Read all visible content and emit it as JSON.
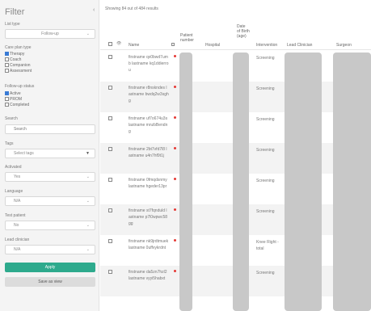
{
  "filters": {
    "title": "Filter",
    "collapse_icon": "chevron-left-icon",
    "list_type": {
      "label": "List type",
      "value": "Follow-up"
    },
    "care_plan_type": {
      "label": "Care plan type",
      "options": [
        {
          "label": "Therapy",
          "checked": true
        },
        {
          "label": "Coach",
          "checked": false
        },
        {
          "label": "Companion",
          "checked": false
        },
        {
          "label": "Assessment",
          "checked": false
        }
      ]
    },
    "follow_up_status": {
      "label": "Follow-up status",
      "options": [
        {
          "label": "Active",
          "checked": true
        },
        {
          "label": "PROM",
          "checked": false
        },
        {
          "label": "Completed",
          "checked": false
        }
      ]
    },
    "search": {
      "label": "Search",
      "placeholder": "Search"
    },
    "tags": {
      "label": "Tags",
      "value": "Select tags"
    },
    "activated": {
      "label": "Activated",
      "value": "Yes"
    },
    "language": {
      "label": "Language",
      "value": "N/A"
    },
    "test_patient": {
      "label": "Test patient",
      "value": "No"
    },
    "lead_clinician": {
      "label": "Lead clinician",
      "value": "N/A"
    },
    "apply_label": "Apply",
    "save_label": "Save as view"
  },
  "results_text": "Showing 84 out of 484 results",
  "table": {
    "columns": {
      "eye": "👁",
      "name": "Name",
      "patient_number": "Patient number",
      "hospital": "Hospital",
      "dob": "Date of Birth (age)",
      "intervention": "Intervention",
      "lead_clinician": "Lead Clinician",
      "surgeon": "Surgeon"
    },
    "rows": [
      {
        "name": "firstname qx0bwd7umb lastname kq1ddierrou",
        "intervention": "Screening"
      },
      {
        "name": "firstname r8nskndes lastname bwdq2w3sghg",
        "intervention": "Screening"
      },
      {
        "name": "firstname uf7o674u3s lastname mnzbBendng",
        "intervention": "Screening"
      },
      {
        "name": "firstname 2bt7vfd7l8 lastname u4n7hf9t1j",
        "intervention": "Screening"
      },
      {
        "name": "firstname 0fmqdsnmy lastname hgeder13pr",
        "intervention": "Screening"
      },
      {
        "name": "firstname st7fqnduld lastname p7l0wpwc58gg",
        "intervention": "Screening"
      },
      {
        "name": "firstname nk9jrdtmuek lastname 0uffvykrdnt",
        "intervention": "Knee Right - total"
      },
      {
        "name": "firstname da5zn7hzl2 lastname vyyi5habxt",
        "intervention": "Screening"
      }
    ]
  }
}
